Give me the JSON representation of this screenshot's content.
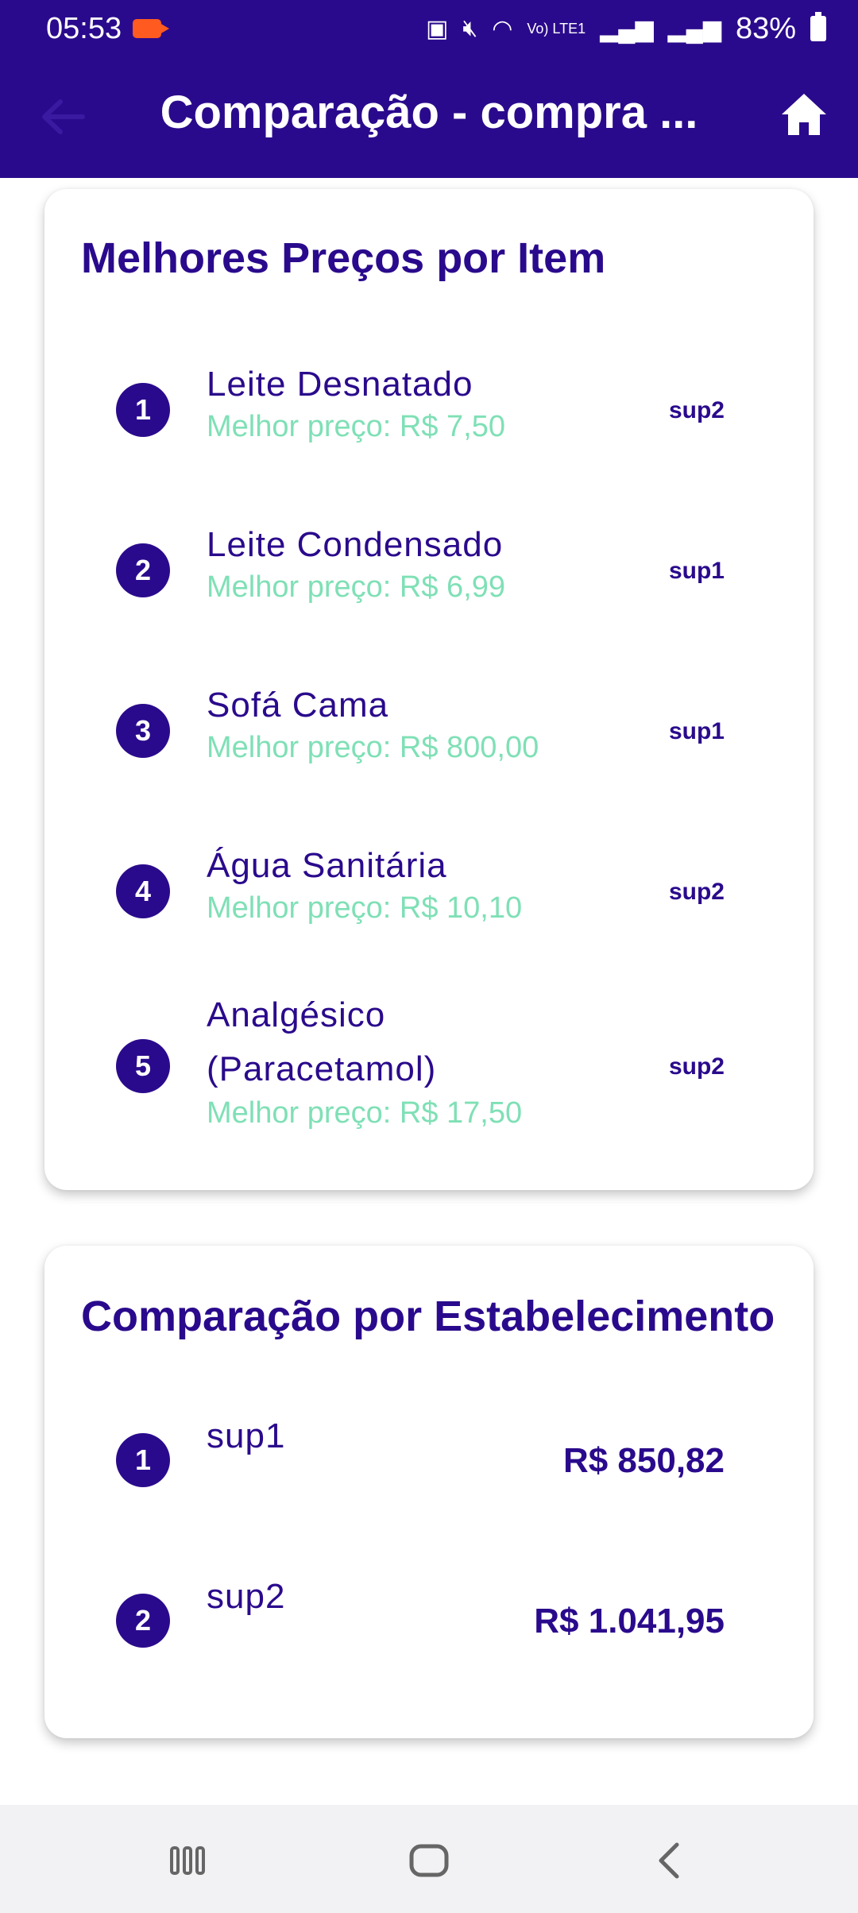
{
  "status_bar": {
    "time": "05:53",
    "battery": "83%",
    "network_label": "Vo) LTE1"
  },
  "app_bar": {
    "title": "Comparação - compra ..."
  },
  "best_prices_card": {
    "title": "Melhores Preços por Item",
    "items": [
      {
        "index": "1",
        "name": "Leite Desnatado",
        "price": "Melhor preço: R$ 7,50",
        "store": "sup2"
      },
      {
        "index": "2",
        "name": "Leite Condensado",
        "price": "Melhor preço: R$ 6,99",
        "store": "sup1"
      },
      {
        "index": "3",
        "name": "Sofá Cama",
        "price": "Melhor preço: R$ 800,00",
        "store": "sup1"
      },
      {
        "index": "4",
        "name": "Água Sanitária",
        "price": "Melhor preço: R$ 10,10",
        "store": "sup2"
      },
      {
        "index": "5",
        "name_line1": "Analgésico",
        "name_line2": "(Paracetamol)",
        "price": "Melhor preço: R$ 17,50",
        "store": "sup2"
      }
    ]
  },
  "store_comparison_card": {
    "title": "Comparação por Estabelecimento",
    "stores": [
      {
        "index": "1",
        "name": "sup1",
        "total": "R$ 850,82"
      },
      {
        "index": "2",
        "name": "sup2",
        "total": "R$ 1.041,95"
      }
    ]
  },
  "colors": {
    "primary": "#2a0a8c",
    "price_green": "#7fe0b6",
    "nav_background": "#f2f1f4"
  }
}
